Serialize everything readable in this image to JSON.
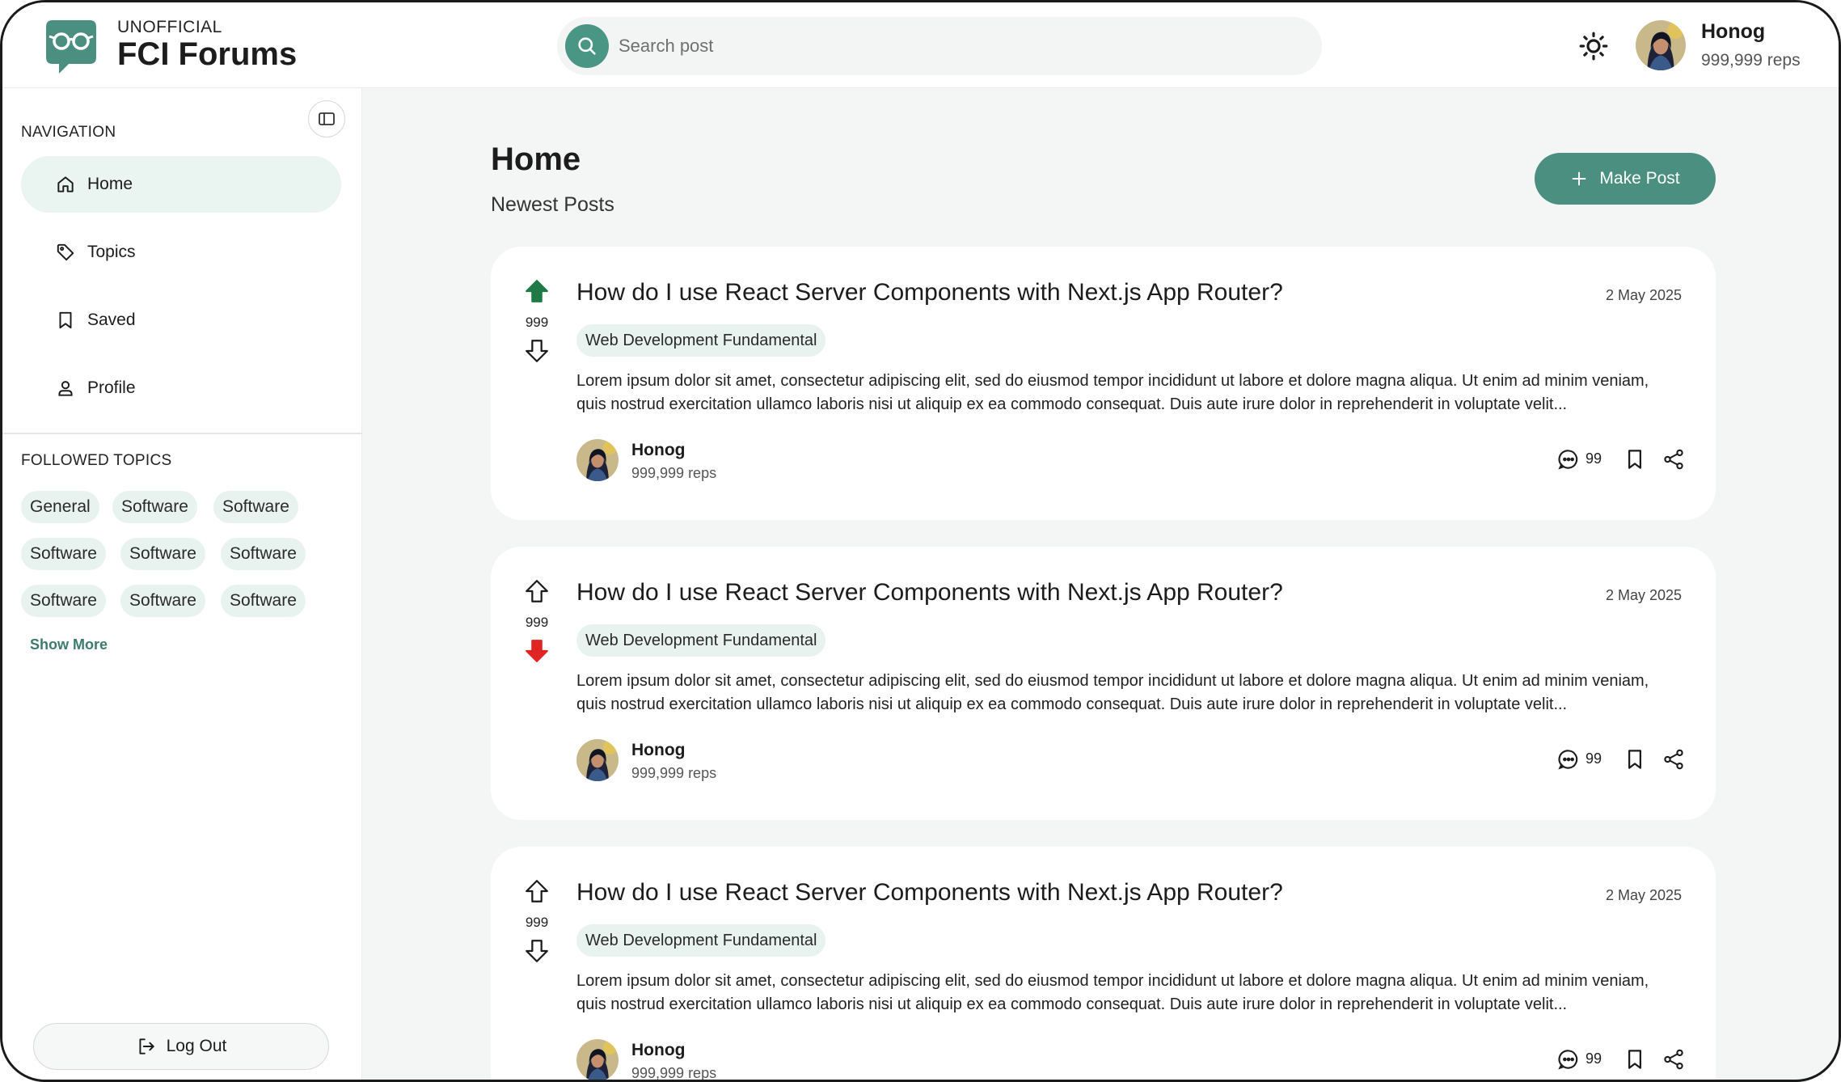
{
  "header": {
    "logo_small": "UNOFFICIAL",
    "logo_big": "FCI Forums",
    "search_placeholder": "Search post",
    "user": {
      "name": "Honog",
      "reps": "999,999 reps"
    }
  },
  "sidebar": {
    "navigation_title": "NAVIGATION",
    "nav_items": [
      {
        "label": "Home",
        "icon": "home-icon",
        "active": true
      },
      {
        "label": "Topics",
        "icon": "tag-icon",
        "active": false
      },
      {
        "label": "Saved",
        "icon": "bookmark-icon",
        "active": false
      },
      {
        "label": "Profile",
        "icon": "user-icon",
        "active": false
      }
    ],
    "followed_title": "FOLLOWED TOPICS",
    "topics": [
      "General",
      "Software",
      "Software",
      "Software",
      "Software",
      "Software",
      "Software",
      "Software",
      "Software"
    ],
    "show_more": "Show More",
    "logout_label": "Log Out"
  },
  "main": {
    "title": "Home",
    "subtitle": "Newest Posts",
    "make_post_label": "Make Post",
    "posts": [
      {
        "title": "How do I use React Server Components with Next.js App Router?",
        "date": "2 May 2025",
        "tag": "Web Development Fundamental",
        "body": "Lorem ipsum dolor sit amet, consectetur adipiscing elit, sed do eiusmod tempor incididunt ut labore et dolore magna aliqua. Ut enim ad minim veniam, quis nostrud exercitation ullamco laboris nisi ut aliquip ex ea commodo consequat. Duis aute irure dolor in reprehenderit in voluptate velit...",
        "votes": "999",
        "vote_state": "up",
        "author": "Honog",
        "author_reps": "999,999 reps",
        "comments": "99"
      },
      {
        "title": "How do I use React Server Components with Next.js App Router?",
        "date": "2 May 2025",
        "tag": "Web Development Fundamental",
        "body": "Lorem ipsum dolor sit amet, consectetur adipiscing elit, sed do eiusmod tempor incididunt ut labore et dolore magna aliqua. Ut enim ad minim veniam, quis nostrud exercitation ullamco laboris nisi ut aliquip ex ea commodo consequat. Duis aute irure dolor in reprehenderit in voluptate velit...",
        "votes": "999",
        "vote_state": "down",
        "author": "Honog",
        "author_reps": "999,999 reps",
        "comments": "99"
      },
      {
        "title": "How do I use React Server Components with Next.js App Router?",
        "date": "2 May 2025",
        "tag": "Web Development Fundamental",
        "body": "Lorem ipsum dolor sit amet, consectetur adipiscing elit, sed do eiusmod tempor incididunt ut labore et dolore magna aliqua. Ut enim ad minim veniam, quis nostrud exercitation ullamco laboris nisi ut aliquip ex ea commodo consequat. Duis aute irure dolor in reprehenderit in voluptate velit...",
        "votes": "999",
        "vote_state": "none",
        "author": "Honog",
        "author_reps": "999,999 reps",
        "comments": "99"
      }
    ]
  },
  "colors": {
    "accent": "#4a8f7f",
    "chip_bg": "#e8f3ef",
    "upvote_active": "#1f7a45",
    "downvote_active": "#e02424"
  }
}
